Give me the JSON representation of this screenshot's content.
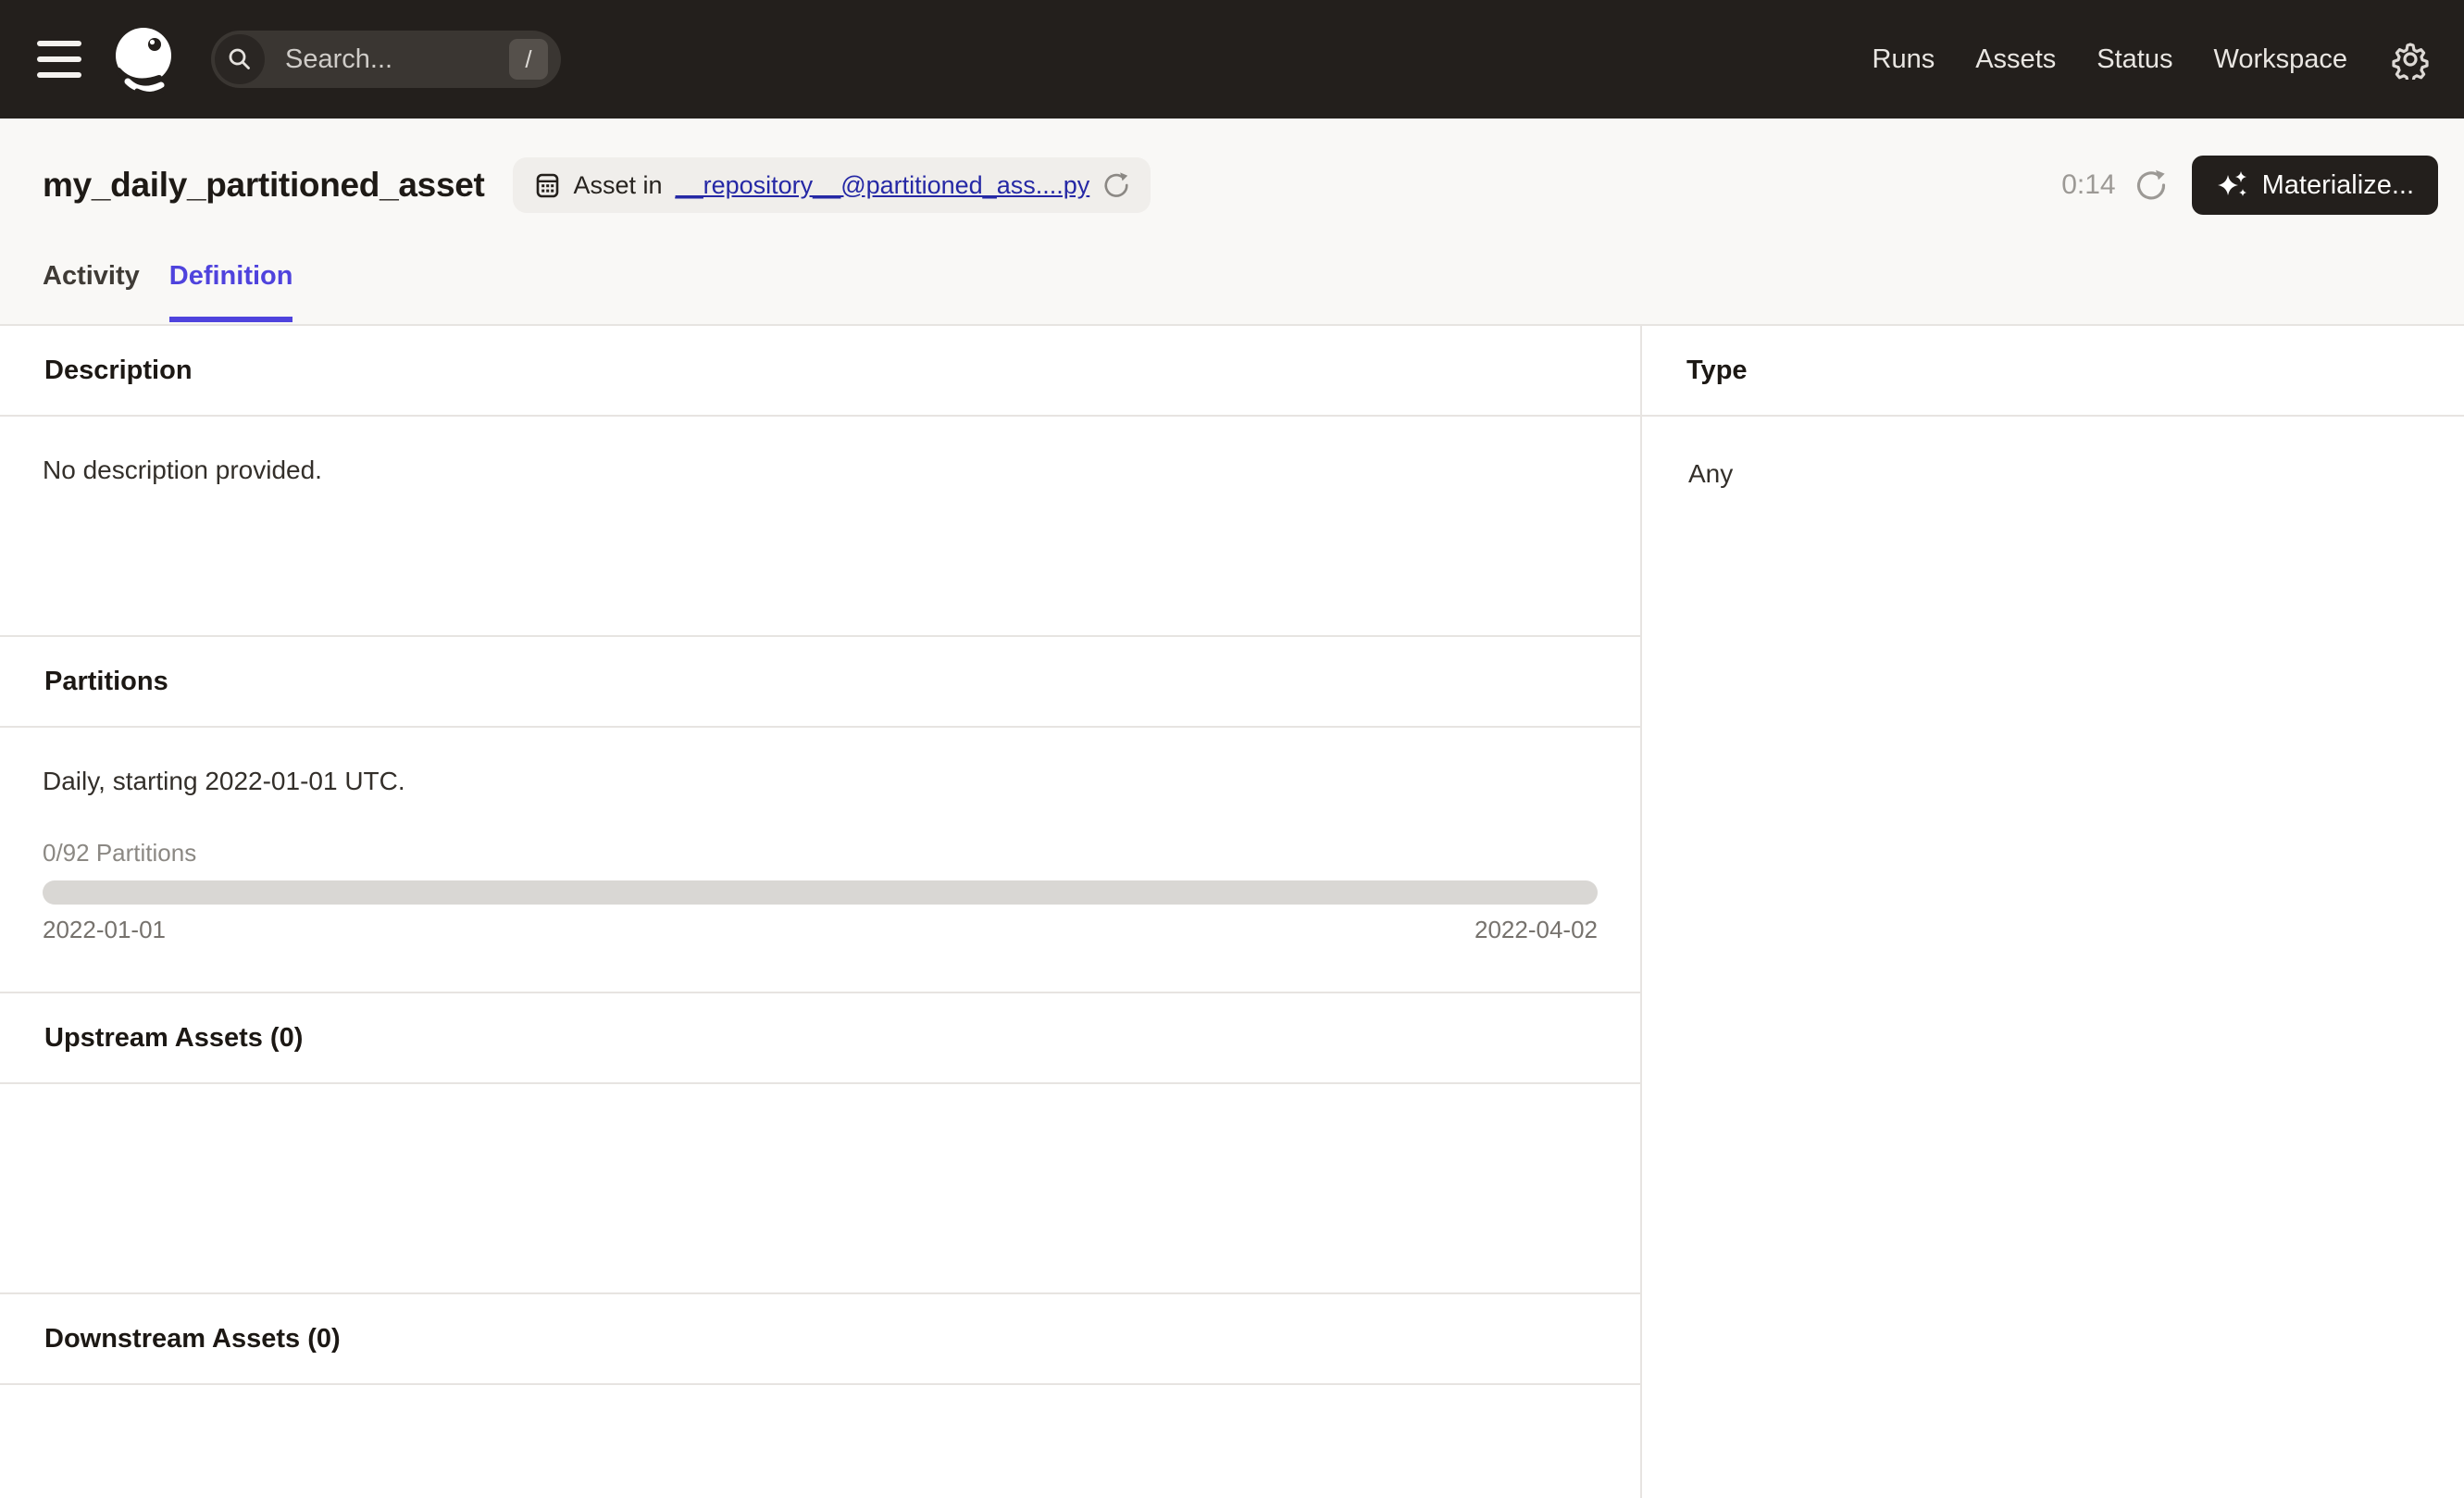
{
  "topnav": {
    "search_placeholder": "Search...",
    "search_shortcut": "/",
    "items": [
      {
        "label": "Runs"
      },
      {
        "label": "Assets"
      },
      {
        "label": "Status"
      },
      {
        "label": "Workspace"
      }
    ]
  },
  "header": {
    "title": "my_daily_partitioned_asset",
    "badge": {
      "prefix": "Asset in",
      "link": "__repository__@partitioned_ass....py"
    },
    "timer": "0:14",
    "materialize_label": "Materialize..."
  },
  "tabs": [
    {
      "label": "Activity",
      "active": false
    },
    {
      "label": "Definition",
      "active": true
    }
  ],
  "sections": {
    "description": {
      "title": "Description",
      "body": "No description provided."
    },
    "partitions": {
      "title": "Partitions",
      "body": "Daily, starting 2022-01-01 UTC.",
      "progress_label": "0/92 Partitions",
      "progress_percent": 0,
      "range_start": "2022-01-01",
      "range_end": "2022-04-02"
    },
    "upstream": {
      "title": "Upstream Assets (0)"
    },
    "downstream": {
      "title": "Downstream Assets (0)"
    },
    "type": {
      "title": "Type",
      "value": "Any"
    }
  },
  "colors": {
    "nav_bg": "#231F1C",
    "accent": "#4F43DD",
    "link": "#2528A5",
    "border": "#E7E4E1",
    "header_bg": "#F9F8F6",
    "progress_track": "#D9D7D4"
  }
}
